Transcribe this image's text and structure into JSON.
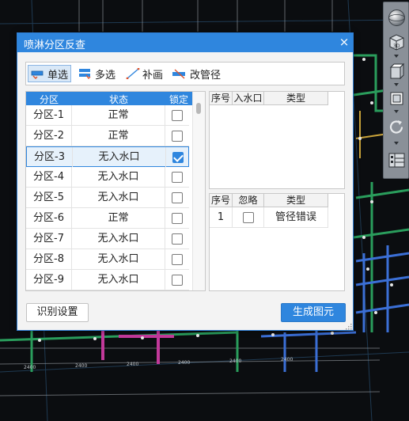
{
  "cad": {
    "dimension_labels": [
      "2400",
      "2400",
      "2400",
      "2400",
      "2400",
      "2400"
    ]
  },
  "dialog": {
    "title": "喷淋分区反查",
    "close_label": "×",
    "modes": [
      {
        "label": "单选",
        "active": true
      },
      {
        "label": "多选",
        "active": false
      },
      {
        "label": "补画",
        "active": false
      },
      {
        "label": "改管径",
        "active": false
      }
    ],
    "partition_table": {
      "headers": {
        "partition": "分区",
        "status": "状态",
        "lock": "锁定"
      },
      "rows": [
        {
          "partition": "分区-1",
          "status": "正常",
          "locked": false
        },
        {
          "partition": "分区-2",
          "status": "正常",
          "locked": false
        },
        {
          "partition": "分区-3",
          "status": "无入水口",
          "locked": true,
          "selected": true
        },
        {
          "partition": "分区-4",
          "status": "无入水口",
          "locked": false
        },
        {
          "partition": "分区-5",
          "status": "无入水口",
          "locked": false
        },
        {
          "partition": "分区-6",
          "status": "正常",
          "locked": false
        },
        {
          "partition": "分区-7",
          "status": "无入水口",
          "locked": false
        },
        {
          "partition": "分区-8",
          "status": "无入水口",
          "locked": false
        },
        {
          "partition": "分区-9",
          "status": "无入水口",
          "locked": false
        }
      ]
    },
    "inlet_table": {
      "headers": {
        "index": "序号",
        "inlet": "入水口",
        "type": "类型"
      }
    },
    "error_table": {
      "headers": {
        "index": "序号",
        "ignore": "忽略",
        "type": "类型"
      },
      "rows": [
        {
          "index": "1",
          "ignored": false,
          "type": "管径错误"
        }
      ]
    },
    "footer": {
      "settings_label": "识别设置",
      "generate_label": "生成图元"
    }
  },
  "colors": {
    "accent": "#2f86de",
    "cad_background": "#0b0d10"
  }
}
